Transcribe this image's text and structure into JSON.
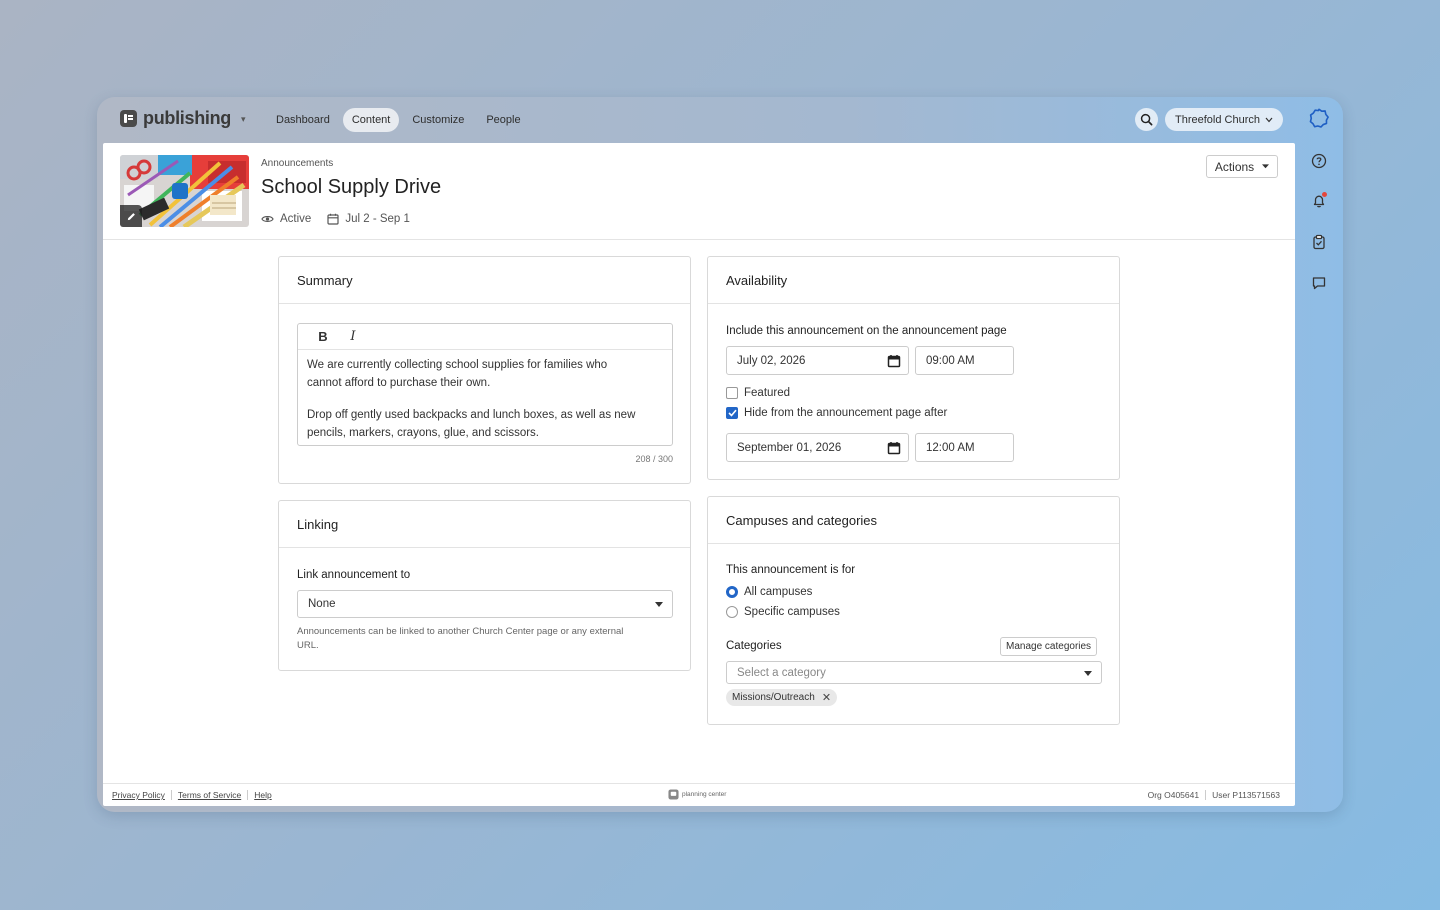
{
  "app": {
    "name": "publishing",
    "nav": [
      "Dashboard",
      "Content",
      "Customize",
      "People"
    ],
    "active_nav": "Content",
    "org_name": "Threefold Church"
  },
  "header": {
    "breadcrumb": "Announcements",
    "title": "School Supply Drive",
    "status": "Active",
    "date_range": "Jul 2 - Sep 1",
    "actions_label": "Actions"
  },
  "summary": {
    "heading": "Summary",
    "bold_label": "B",
    "italic_label": "I",
    "paragraph1": "We are currently collecting school supplies for families who cannot afford to purchase their own.",
    "paragraph2": "Drop off gently used backpacks and lunch boxes, as well as new pencils, markers, crayons, glue, and scissors.",
    "counter": "208 / 300"
  },
  "linking": {
    "heading": "Linking",
    "label": "Link announcement to",
    "selected": "None",
    "help": "Announcements can be linked to another Church Center page or any external URL."
  },
  "availability": {
    "heading": "Availability",
    "include_label": "Include this announcement on the announcement page",
    "start_date": "July 02, 2026",
    "start_time": "09:00 AM",
    "featured_label": "Featured",
    "featured_checked": false,
    "hide_label": "Hide from the announcement page after",
    "hide_checked": true,
    "end_date": "September 01, 2026",
    "end_time": "12:00 AM"
  },
  "campuses": {
    "heading": "Campuses and categories",
    "for_label": "This announcement is for",
    "option_all": "All campuses",
    "option_specific": "Specific campuses",
    "selected_option": "All campuses",
    "categories_label": "Categories",
    "manage_label": "Manage categories",
    "category_placeholder": "Select a category",
    "tags": [
      "Missions/Outreach"
    ]
  },
  "footer": {
    "links": [
      "Privacy Policy",
      "Terms of Service",
      "Help"
    ],
    "brand": "planning center",
    "org_id": "Org O405641",
    "user_id": "User P113571563"
  },
  "colors": {
    "accent": "#2266c7",
    "notification": "#e4463b",
    "rail_logo": "#1f5fc4"
  },
  "icons": [
    "search-icon",
    "chevron-down-icon",
    "help-icon",
    "bell-icon",
    "clipboard-check-icon",
    "chat-icon",
    "eye-icon",
    "calendar-icon",
    "pencil-icon",
    "close-icon"
  ]
}
